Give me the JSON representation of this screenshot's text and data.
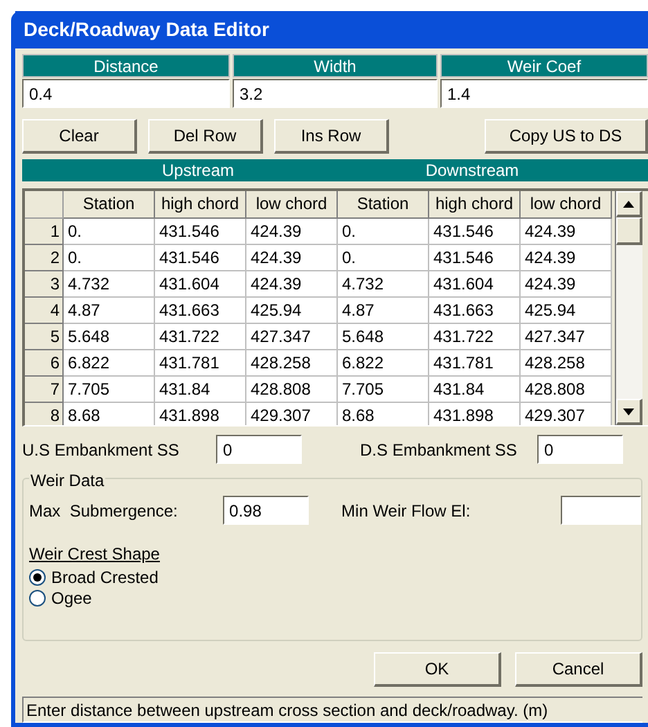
{
  "window": {
    "title": "Deck/Roadway Data Editor"
  },
  "top_fields": [
    {
      "label": "Distance",
      "value": "0.4"
    },
    {
      "label": "Width",
      "value": "3.2"
    },
    {
      "label": "Weir Coef",
      "value": "1.4"
    }
  ],
  "buttons": [
    "Clear",
    "Del Row",
    "Ins Row",
    "Copy US to DS"
  ],
  "table": {
    "groups": [
      "Upstream",
      "Downstream"
    ],
    "columns": [
      "Station",
      "high chord",
      "low chord",
      "Station",
      "high chord",
      "low chord"
    ],
    "rows": [
      {
        "number": "1",
        "cells": [
          "0.",
          "431.546",
          "424.39",
          "0.",
          "431.546",
          "424.39"
        ]
      },
      {
        "number": "2",
        "cells": [
          "0.",
          "431.546",
          "424.39",
          "0.",
          "431.546",
          "424.39"
        ]
      },
      {
        "number": "3",
        "cells": [
          "4.732",
          "431.604",
          "424.39",
          "4.732",
          "431.604",
          "424.39"
        ]
      },
      {
        "number": "4",
        "cells": [
          "4.87",
          "431.663",
          "425.94",
          "4.87",
          "431.663",
          "425.94"
        ]
      },
      {
        "number": "5",
        "cells": [
          "5.648",
          "431.722",
          "427.347",
          "5.648",
          "431.722",
          "427.347"
        ]
      },
      {
        "number": "6",
        "cells": [
          "6.822",
          "431.781",
          "428.258",
          "6.822",
          "431.781",
          "428.258"
        ]
      },
      {
        "number": "7",
        "cells": [
          "7.705",
          "431.84",
          "428.808",
          "7.705",
          "431.84",
          "428.808"
        ]
      },
      {
        "number": "8",
        "cells": [
          "8.68",
          "431.898",
          "429.307",
          "8.68",
          "431.898",
          "429.307"
        ]
      }
    ]
  },
  "embankment": [
    {
      "label": "U.S Embankment SS",
      "value": "0"
    },
    {
      "label": "D.S Embankment SS",
      "value": "0"
    }
  ],
  "weir_data": {
    "title": "Weir Data",
    "max_submergence": {
      "label": "Max  Submergence:",
      "value": "0.98"
    },
    "min_weir_flow": {
      "label": "Min Weir Flow El:"
    },
    "crest_shape": {
      "label": "Weir Crest Shape",
      "options": [
        {
          "label": "Broad Crested",
          "selected": true
        },
        {
          "label": "Ogee",
          "selected": false
        }
      ]
    }
  },
  "dialog_buttons": [
    "OK",
    "Cancel"
  ],
  "status_bar": "Enter distance between upstream cross section and deck/roadway. (m)"
}
